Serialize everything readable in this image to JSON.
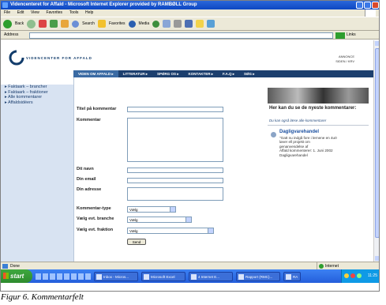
{
  "window": {
    "title": "Videncenteret for Affald - Microsoft Internet Explorer provided by RAMBØLL Group"
  },
  "menu": [
    "File",
    "Edit",
    "View",
    "Favorites",
    "Tools",
    "Help"
  ],
  "toolbar": {
    "back": "Back",
    "search": "Search",
    "favorites": "Favorites",
    "media": "Media"
  },
  "address": {
    "label": "Address",
    "go": "Go",
    "links": "Links"
  },
  "site": {
    "logo_text": "VIDENCENTER FOR AFFALD",
    "header_right": [
      "ANNONCE",
      "SIDEN / KRV"
    ],
    "nav": [
      {
        "label": "VIDEN OM AFFALD ▸",
        "active": true
      },
      {
        "label": "LITTERATUR ▸",
        "active": false
      },
      {
        "label": "SPØRG OS ▸",
        "active": false
      },
      {
        "label": "KONTAKTER ▸",
        "active": false
      },
      {
        "label": "F.A.Q ▸",
        "active": false
      },
      {
        "label": "SØG ▸",
        "active": false
      }
    ],
    "sidebar": [
      "▸ Faktaark – brancher",
      "▸ Faktaark – fraktioner",
      "▸ Alle kommentarer",
      "▸ Affaldsidéers"
    ]
  },
  "form": {
    "title_label": "Titel på kommentar",
    "comment_label": "Kommentar",
    "name_label": "Dit navn",
    "email_label": "Din email",
    "address_label": "Din adresse",
    "type_label": "Kommentar-type",
    "branch_label": "Vælg evt. branche",
    "fraction_label": "Vælg evt. fraktion",
    "type_value": "Vælg",
    "branch_value": "Vælg",
    "fraction_value": "Vælg",
    "submit": "Send"
  },
  "right_panel": {
    "heading": "Her kan du se de nyeste kommentarer:",
    "subtitle": "Du kan også læse alle kommentarer",
    "item_title": "Dagligvarehandel",
    "item_lines": [
      "\"Gatt nu indgå fore i lernene en 4u0",
      "løver ell projekt om",
      "genanvendelse af",
      "Affald kommenterer: 1. Juni 2002",
      "Dagligvarehandel"
    ]
  },
  "status": {
    "left": "Done",
    "zone": "Internet"
  },
  "taskbar": {
    "start": "start",
    "tasks": [
      "Inbox - Micros...",
      "Microsoft Excel",
      "4 Internet E...",
      "Rapport (RMC)...",
      "RA"
    ],
    "clock": "11:25"
  },
  "caption": "Figur 6. Kommentarfelt"
}
